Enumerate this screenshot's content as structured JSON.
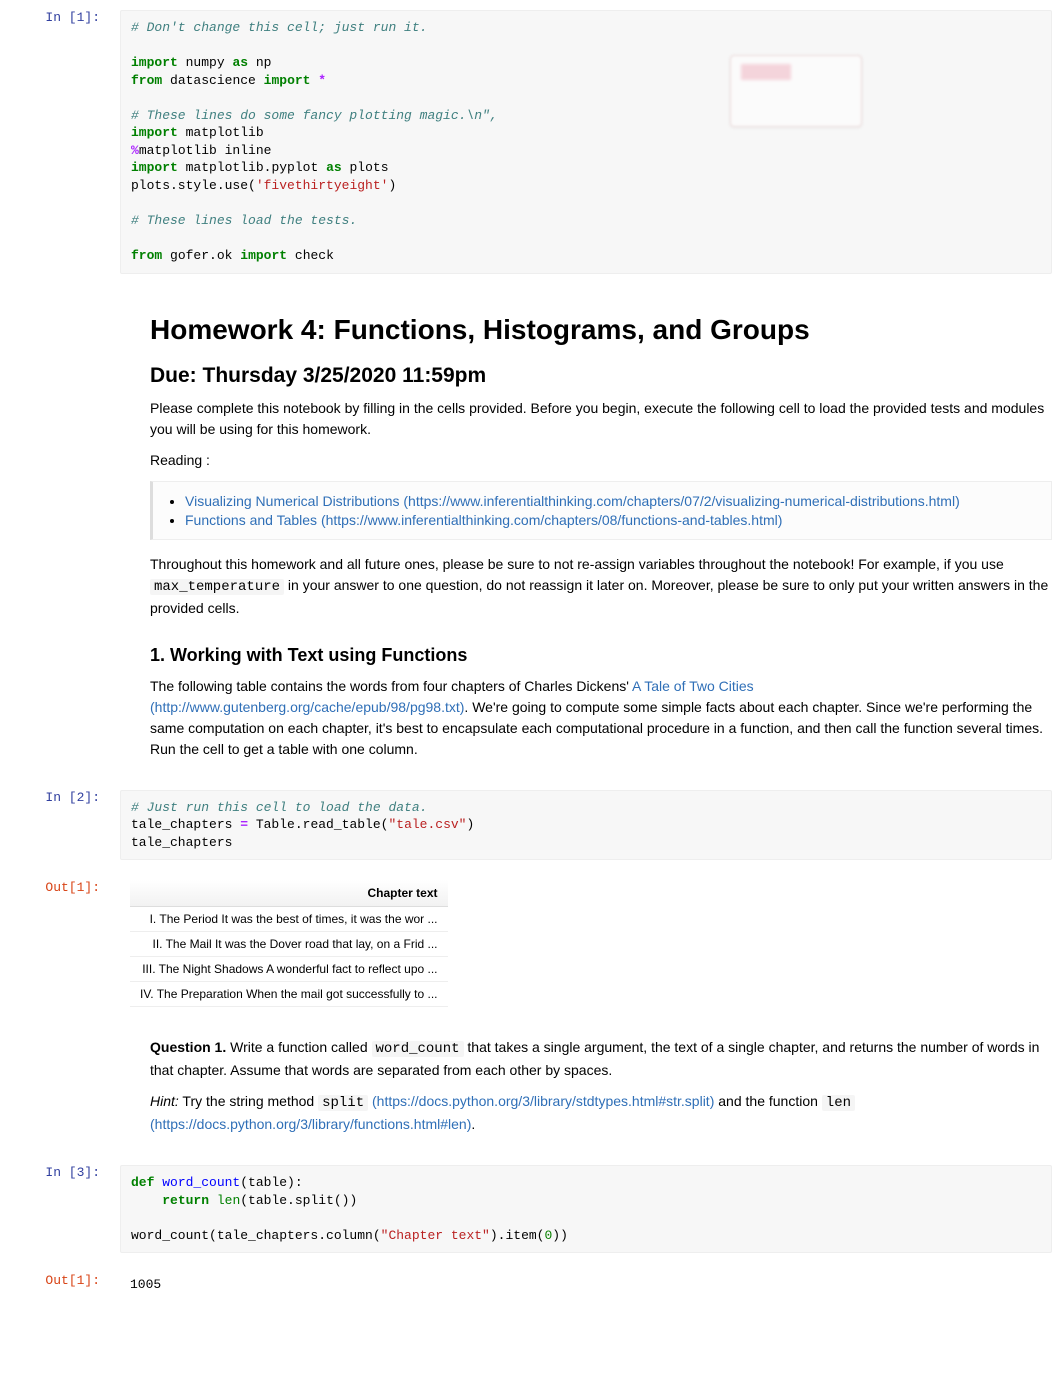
{
  "prompts": {
    "in1": "In [1]:",
    "in2": "In [2]:",
    "in3": "In [3]:",
    "out1a": "Out[1]:",
    "out1b": "Out[1]:"
  },
  "cell1": {
    "c1": "# Don't change this cell; just run it.",
    "kw_import1": "import",
    "numpy": "numpy",
    "kw_as": "as",
    "np": "np",
    "kw_from": "from",
    "datascience": "datascience",
    "kw_import2": "import",
    "star": "*",
    "c2": "# These lines do some fancy plotting magic.\\n\",",
    "kw_import3": "import",
    "matplotlib": "matplotlib",
    "magic": "%",
    "magictxt": "matplotlib inline",
    "kw_import4": "import",
    "mpl_pyplot": "matplotlib.pyplot",
    "kw_as2": "as",
    "plots": "plots",
    "plots_style": "plots.style.use(",
    "style_str": "'fivethirtyeight'",
    "close_p": ")",
    "c3": "# These lines load the tests.",
    "kw_from2": "from",
    "gofer": "gofer.ok",
    "kw_import5": "import",
    "check": "check"
  },
  "md1": {
    "h1": "Homework 4: Functions, Histograms, and Groups",
    "h2": "Due: Thursday 3/25/2020 11:59pm",
    "p1": "Please complete this notebook by filling in the cells provided. Before you begin, execute the following cell to load the provided tests and modules you will be using for this homework.",
    "reading_label": "Reading :",
    "link1_text": "Visualizing Numerical Distributions",
    "link1_url": " (https://www.inferentialthinking.com/chapters/07/2/visualizing-numerical-distributions.html)",
    "link2_text": "Functions and Tables",
    "link2_url": " (https://www.inferentialthinking.com/chapters/08/functions-and-tables.html)",
    "p2a": "Throughout this homework and all future ones, please be sure to not re-assign variables throughout the notebook! For example, if you use ",
    "p2_code": "max_temperature",
    "p2b": " in your answer to one question, do not reassign it later on. Moreover, please be sure to only put your written answers in the provided cells.",
    "h3": "1. Working with Text using Functions",
    "p3a": "The following table contains the words from four chapters of Charles Dickens' ",
    "p3_link_text": "A Tale of Two Cities",
    "p3_link_url": " (http://www.gutenberg.org/cache/epub/98/pg98.txt)",
    "p3b": ". We're going to compute some simple facts about each chapter. Since we're performing the same computation on each chapter, it's best to encapsulate each computational procedure in a function, and then call the function several times. Run the cell to get a table with one column."
  },
  "cell2": {
    "c1": "# Just run this cell to load the data.",
    "line2a": "tale_chapters ",
    "eq": "=",
    "line2b": " Table.read_table(",
    "str": "\"tale.csv\"",
    "close": ")",
    "line3": "tale_chapters"
  },
  "table": {
    "header": "Chapter text",
    "rows": [
      "I. The Period It was the best of times, it was the wor ...",
      "II. The Mail It was the Dover road that lay, on a Frid ...",
      "III. The Night Shadows A wonderful fact to reflect upo ...",
      "IV. The Preparation When the mail got successfully to ..."
    ]
  },
  "md2": {
    "q": "Question 1.",
    "q_text_a": " Write a function called ",
    "q_code": "word_count",
    "q_text_b": " that takes a single argument, the text of a single chapter, and returns the number of words in that chapter. Assume that words are separated from each other by spaces.",
    "hint": "Hint:",
    "hint_a": " Try the string method ",
    "hint_code1": "split",
    "hint_url1": " (https://docs.python.org/3/library/stdtypes.html#str.split)",
    "hint_b": " and the function ",
    "hint_code2": "len",
    "hint_url2": " (https://docs.python.org/3/library/functions.html#len)",
    "hint_c": "."
  },
  "cell3": {
    "def": "def",
    "fn": "word_count",
    "sig": "(table):",
    "ret": "return",
    "len": "len",
    "ret_body": "(table.split())",
    "call_a": "word_count(tale_chapters.column(",
    "call_str": "\"Chapter text\"",
    "call_b": ").item(",
    "zero": "0",
    "call_c": "))"
  },
  "out3": {
    "value": "1005"
  }
}
